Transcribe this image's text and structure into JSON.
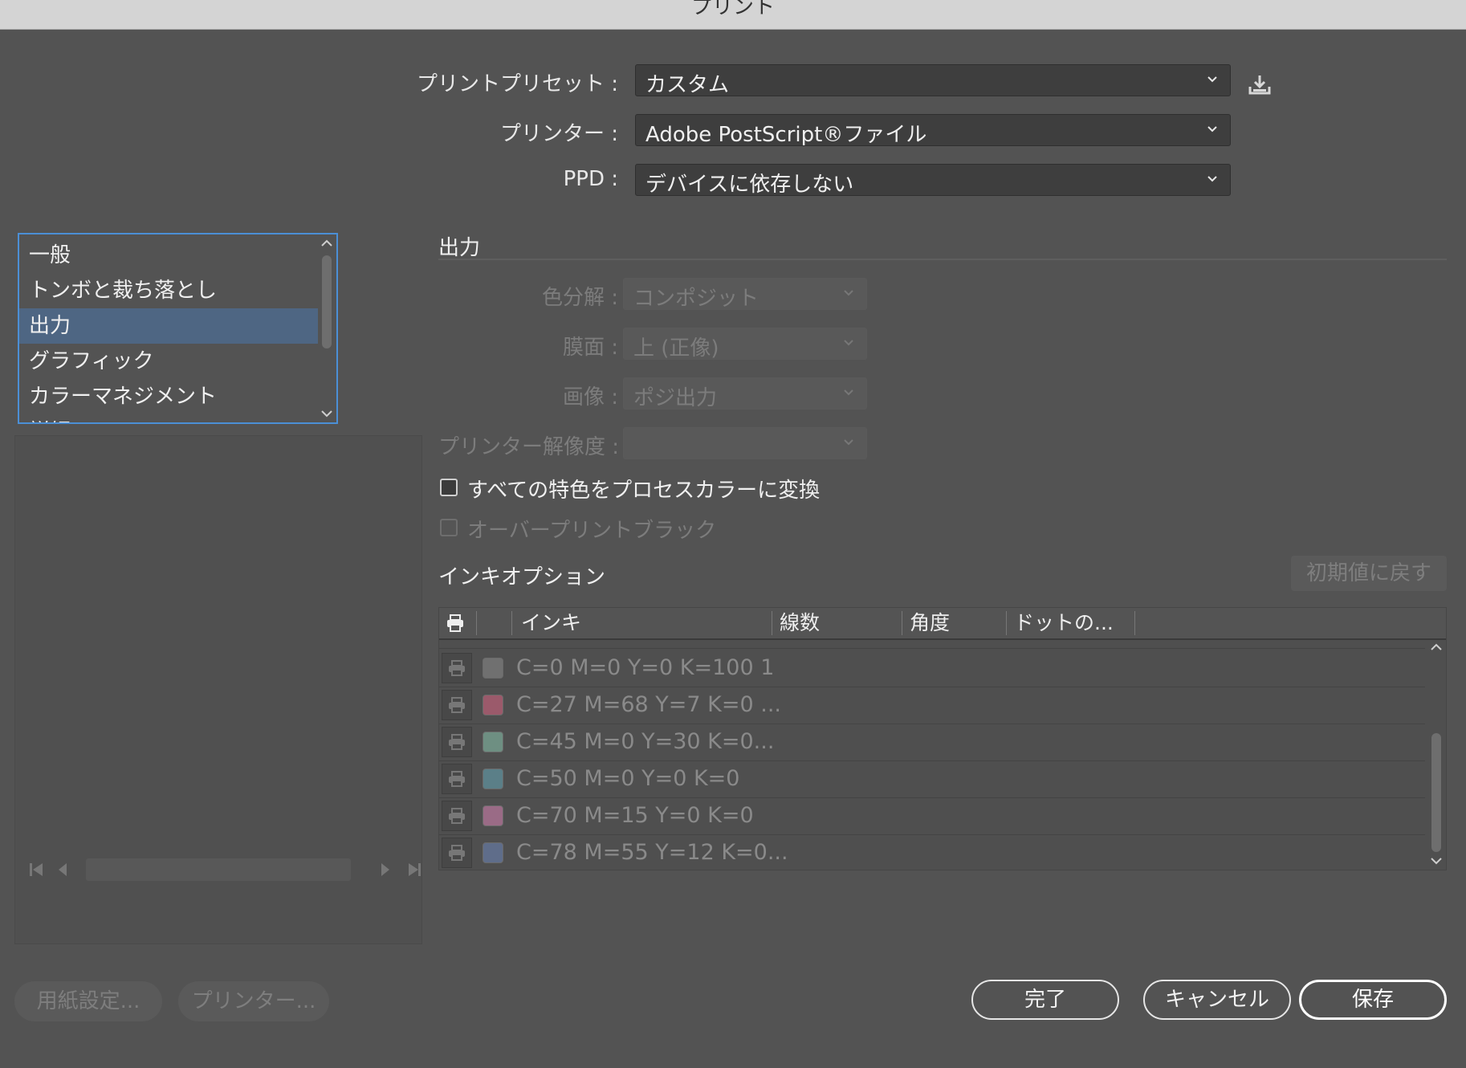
{
  "window": {
    "title": "プリント"
  },
  "preset": {
    "label": "プリントプリセット :",
    "value": "カスタム"
  },
  "printer": {
    "label": "プリンター :",
    "value": "Adobe PostScript®ファイル"
  },
  "ppd": {
    "label": "PPD :",
    "value": "デバイスに依存しない"
  },
  "categories": {
    "items": [
      "一般",
      "トンボと裁ち落とし",
      "出力",
      "グラフィック",
      "カラーマネジメント",
      "詳細"
    ],
    "selected": "出力"
  },
  "output": {
    "section_title": "出力",
    "separation": {
      "label": "色分解 :",
      "value": "コンポジット"
    },
    "emulsion": {
      "label": "膜面 :",
      "value": "上 (正像)"
    },
    "image": {
      "label": "画像 :",
      "value": "ポジ出力"
    },
    "resolution": {
      "label": "プリンター解像度 :",
      "value": ""
    },
    "convert_spot": {
      "label": "すべての特色をプロセスカラーに変換",
      "checked": false
    },
    "overprint_black": {
      "label": "オーバープリントブラック",
      "checked": false,
      "enabled": false
    }
  },
  "ink_options": {
    "section_title": "インキオプション",
    "reset_label": "初期値に戻す",
    "columns": [
      "インキ",
      "線数",
      "角度",
      "ドットの..."
    ],
    "rows": [
      {
        "name": "C=0 M=0 Y=0 K=100 1",
        "swatch": "#707070"
      },
      {
        "name": "C=27 M=68 Y=7 K=0 ...",
        "swatch": "#9b5a6b"
      },
      {
        "name": "C=45 M=0 Y=30 K=0...",
        "swatch": "#6e8f82"
      },
      {
        "name": "C=50 M=0 Y=0 K=0",
        "swatch": "#5b7f88"
      },
      {
        "name": "C=70 M=15 Y=0 K=0",
        "swatch": "#9a6b86"
      },
      {
        "name": "C=78 M=55 Y=12 K=0...",
        "swatch": "#5f6d8a"
      }
    ]
  },
  "footer": {
    "page_setup": "用紙設定...",
    "printer_btn": "プリンター...",
    "done": "完了",
    "cancel": "キャンセル",
    "save": "保存"
  },
  "colors": {
    "background": "#535353",
    "accent": "#4b8fd6",
    "selection": "#4e6683"
  }
}
